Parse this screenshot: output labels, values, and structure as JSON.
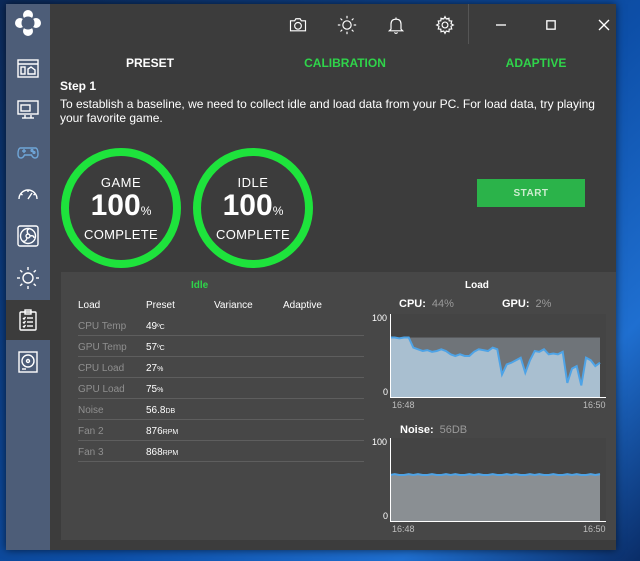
{
  "sidebar": {
    "items": [
      {
        "icon": "dashboard-icon"
      },
      {
        "icon": "monitor-icon"
      },
      {
        "icon": "gamepad-icon"
      },
      {
        "icon": "speedometer-icon"
      },
      {
        "icon": "fan-icon"
      },
      {
        "icon": "brightness-icon"
      },
      {
        "icon": "clipboard-list-icon",
        "active": true
      },
      {
        "icon": "disk-icon"
      }
    ]
  },
  "titlebar": {
    "icons": [
      "camera-icon",
      "brightness-icon",
      "bell-icon",
      "gear-icon",
      "minimize-icon",
      "maximize-icon",
      "close-icon"
    ]
  },
  "tabs": [
    {
      "label": "PRESET"
    },
    {
      "label": "CALIBRATION"
    },
    {
      "label": "ADAPTIVE"
    }
  ],
  "step": {
    "title": "Step 1",
    "text": "To establish a baseline, we need to collect idle and load data from your PC. For load data, try playing your favorite game."
  },
  "progress": {
    "game": {
      "label": "GAME",
      "value": "100",
      "unit": "%",
      "status": "COMPLETE"
    },
    "idle": {
      "label": "IDLE",
      "value": "100",
      "unit": "%",
      "status": "COMPLETE"
    }
  },
  "start_button": {
    "label": "START"
  },
  "idle_section": {
    "heading": "Idle",
    "columns": [
      "Load",
      "Preset",
      "Variance",
      "Adaptive"
    ],
    "rows": [
      {
        "label": "CPU Temp",
        "value": "49",
        "unit": "ºC"
      },
      {
        "label": "GPU Temp",
        "value": "57",
        "unit": "ºC"
      },
      {
        "label": "CPU Load",
        "value": "27",
        "unit": "%"
      },
      {
        "label": "GPU Load",
        "value": "75",
        "unit": "%"
      },
      {
        "label": "Noise",
        "value": "56.8",
        "unit": "DB"
      },
      {
        "label": "Fan 2",
        "value": "876",
        "unit": "RPM"
      },
      {
        "label": "Fan 3",
        "value": "868",
        "unit": "RPM"
      }
    ]
  },
  "load_section": {
    "heading": "Load"
  },
  "colors": {
    "accent_green": "#1ee33c",
    "cpu_area": "#a9bfd0",
    "gpu_area": "#6f7479",
    "line_blue": "#4ea3e6"
  },
  "chart_data": [
    {
      "type": "area",
      "title": "",
      "series": [
        {
          "name": "CPU:",
          "current_label": "44%",
          "values": [
            72,
            72,
            71,
            72,
            72,
            60,
            58,
            56,
            57,
            55,
            56,
            58,
            56,
            52,
            50,
            52,
            50,
            50,
            55,
            58,
            57,
            56,
            60,
            58,
            28,
            40,
            42,
            45,
            48,
            30,
            45,
            56,
            55,
            58,
            52,
            53,
            52,
            55,
            18,
            35,
            38,
            15,
            48,
            45,
            38,
            42
          ]
        },
        {
          "name": "GPU:",
          "current_label": "2%",
          "values": [
            8,
            8,
            8,
            8,
            8,
            8,
            8,
            8,
            8,
            8,
            8,
            8,
            8,
            8,
            8,
            8,
            8,
            8,
            8,
            8,
            8,
            8,
            8,
            8,
            8,
            8,
            8,
            8,
            8,
            8,
            8,
            8,
            8,
            8,
            8,
            8,
            8,
            8,
            8,
            8,
            8,
            8,
            8,
            8,
            8,
            8
          ]
        }
      ],
      "y_labels": [
        "100",
        "0"
      ],
      "ylim": [
        0,
        100
      ],
      "x_labels": [
        "16:48",
        "16:50"
      ]
    },
    {
      "type": "area",
      "title": "",
      "series": [
        {
          "name": "Noise:",
          "current_label": "56DB",
          "values": [
            56,
            57,
            56,
            56,
            57,
            56,
            57,
            56,
            56,
            57,
            56,
            56,
            57,
            56,
            57,
            56,
            56,
            57,
            56,
            57,
            56,
            56,
            57,
            56,
            56,
            57,
            56,
            57,
            56,
            56,
            57,
            56,
            57,
            56,
            56,
            57,
            56,
            56,
            57,
            56,
            57,
            56,
            56,
            57,
            56,
            57
          ]
        }
      ],
      "y_labels": [
        "100",
        "0"
      ],
      "ylim": [
        0,
        100
      ],
      "x_labels": [
        "16:48",
        "16:50"
      ]
    }
  ]
}
